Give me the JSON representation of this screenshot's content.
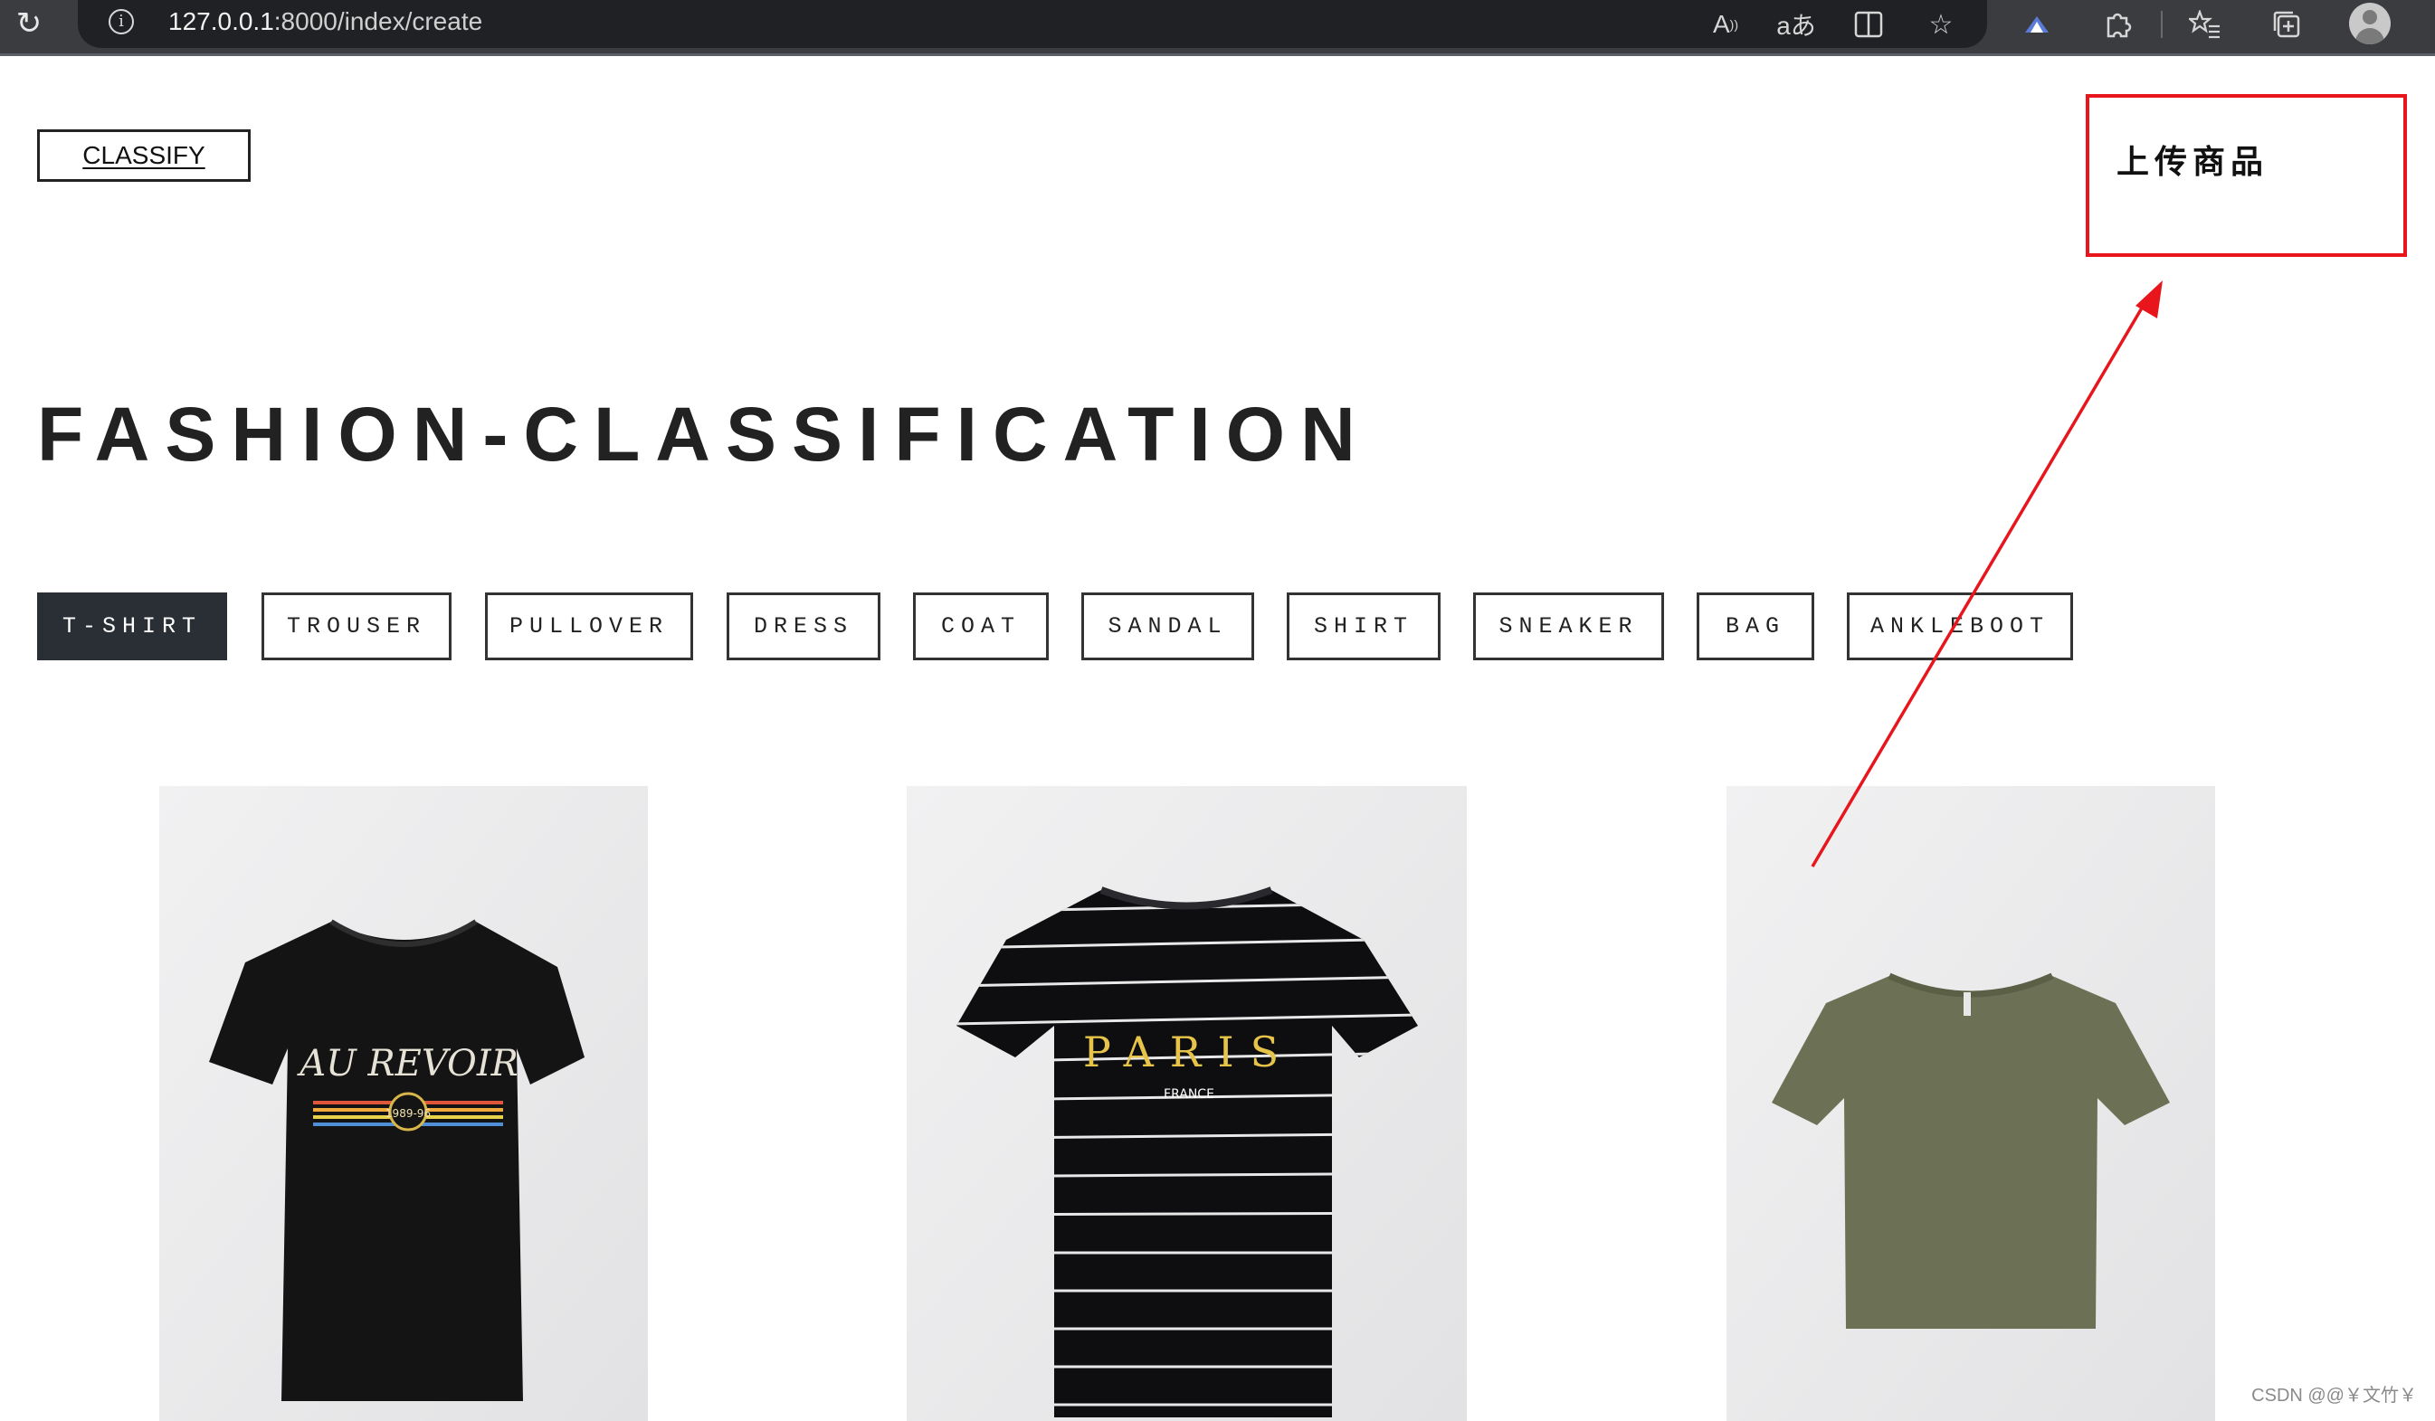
{
  "browser": {
    "url_host": "127.0.0.1",
    "url_rest": ":8000/index/create",
    "icons": [
      "reload-icon",
      "info-icon",
      "read-aloud-icon",
      "translate-icon",
      "split-screen-icon",
      "favorite-star-icon",
      "extension-app-icon",
      "extensions-puzzle-icon",
      "favorites-icon",
      "collections-icon",
      "profile-avatar-icon"
    ]
  },
  "header": {
    "logo": "CLASSIFY",
    "upload_label": "上传商品"
  },
  "page_title": "FASHION-CLASSIFICATION",
  "categories": [
    {
      "label": "T-SHIRT",
      "active": true
    },
    {
      "label": "TROUSER",
      "active": false
    },
    {
      "label": "PULLOVER",
      "active": false
    },
    {
      "label": "DRESS",
      "active": false
    },
    {
      "label": "COAT",
      "active": false
    },
    {
      "label": "SANDAL",
      "active": false
    },
    {
      "label": "SHIRT",
      "active": false
    },
    {
      "label": "SNEAKER",
      "active": false
    },
    {
      "label": "BAG",
      "active": false
    },
    {
      "label": "ANKLEBOOT",
      "active": false
    }
  ],
  "products": [
    {
      "print_text": "AU REVOIR",
      "print_sub": "1989-96",
      "shirt_color": "#141414"
    },
    {
      "print_text": "PARIS",
      "print_sub": "FRANCE",
      "shirt_color": "#0e0e10"
    },
    {
      "print_text": "",
      "print_sub": "",
      "shirt_color": "#6c7155"
    }
  ],
  "colors": {
    "annotation_red": "#e8161c",
    "active_filter_bg": "#2a2e35"
  },
  "watermark": "CSDN @@￥文竹￥"
}
